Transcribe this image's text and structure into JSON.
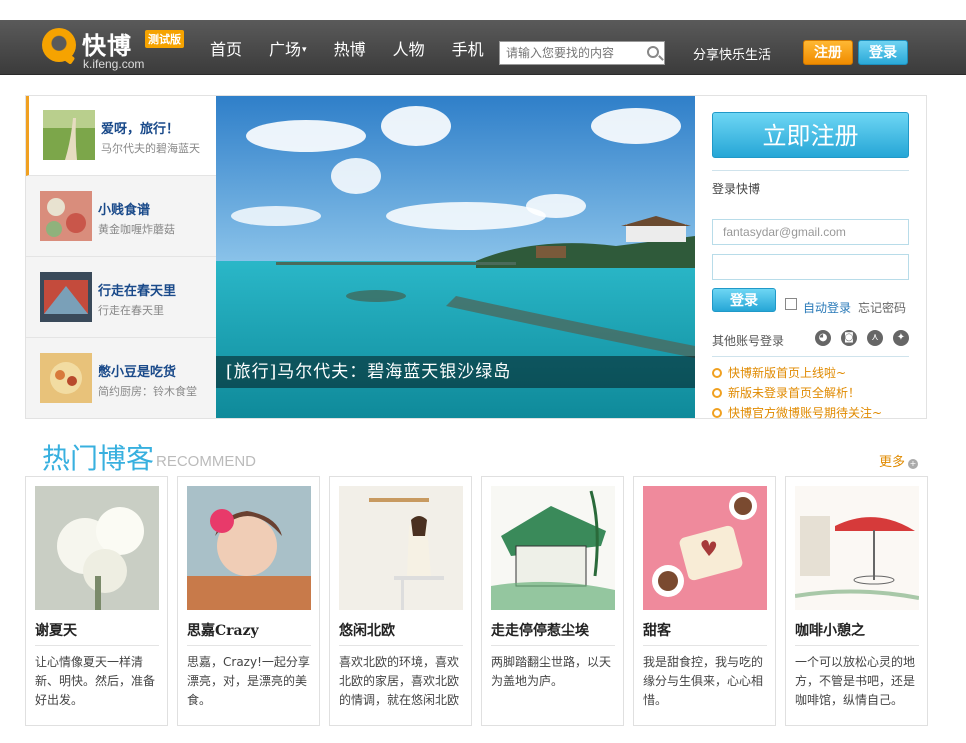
{
  "header": {
    "logo_text": "快博",
    "logo_sub": "k.ifeng.com",
    "beta": "测试版",
    "nav": [
      {
        "label": "首页"
      },
      {
        "label": "广场"
      },
      {
        "label": "热博"
      },
      {
        "label": "人物"
      },
      {
        "label": "手机"
      }
    ],
    "search_placeholder": "请输入您要找的内容",
    "slogan": "分享快乐生活",
    "register": "注册",
    "login": "登录"
  },
  "feature": {
    "items": [
      {
        "title": "爱呀，旅行！",
        "desc": "马尔代夫的碧海蓝天"
      },
      {
        "title": "小贱食谱",
        "desc": "黄金咖喱炸蘑菇"
      },
      {
        "title": "行走在春天里",
        "desc": "行走在春天里"
      },
      {
        "title": "憋小豆是吃货",
        "desc": "简约厨房：铃木食堂"
      }
    ],
    "caption": "[旅行]马尔代夫：碧海蓝天银沙绿岛"
  },
  "login_box": {
    "register_now": "立即注册",
    "title": "登录快博",
    "email_value": "fantasydar@gmail.com",
    "password_value": "",
    "login_button": "登录",
    "auto_login": "自动登录",
    "forgot": "忘记密码",
    "other_login": "其他账号登录",
    "news": [
      "快博新版首页上线啦~",
      "新版未登录首页全解析！",
      "快博官方微博账号期待关注~"
    ]
  },
  "recommend": {
    "title": "热门博客",
    "title_en": "RECOMMEND",
    "more": "更多",
    "cards": [
      {
        "name": "谢夏天",
        "desc": "让心情像夏天一样清新、明快。然后，准备好出发。"
      },
      {
        "name": "思嘉Crazy",
        "desc": "思嘉，Crazy!一起分享漂亮，对，是漂亮的美食。"
      },
      {
        "name": "悠闲北欧",
        "desc": "喜欢北欧的环境，喜欢北欧的家居，喜欢北欧的情调，就在悠闲北欧"
      },
      {
        "name": "走走停停惹尘埃",
        "desc": "两脚踏翻尘世路，以天为盖地为庐。"
      },
      {
        "name": "甜客",
        "desc": "我是甜食控，我与吃的缘分与生俱来，心心相惜。"
      },
      {
        "name": "咖啡小憩之",
        "desc": "一个可以放松心灵的地方，不管是书吧，还是咖啡馆，纵情自己。"
      }
    ]
  },
  "colors": {
    "accent_orange": "#f6a300",
    "accent_blue": "#38b0df",
    "header_bg": "#4a4a4a"
  }
}
